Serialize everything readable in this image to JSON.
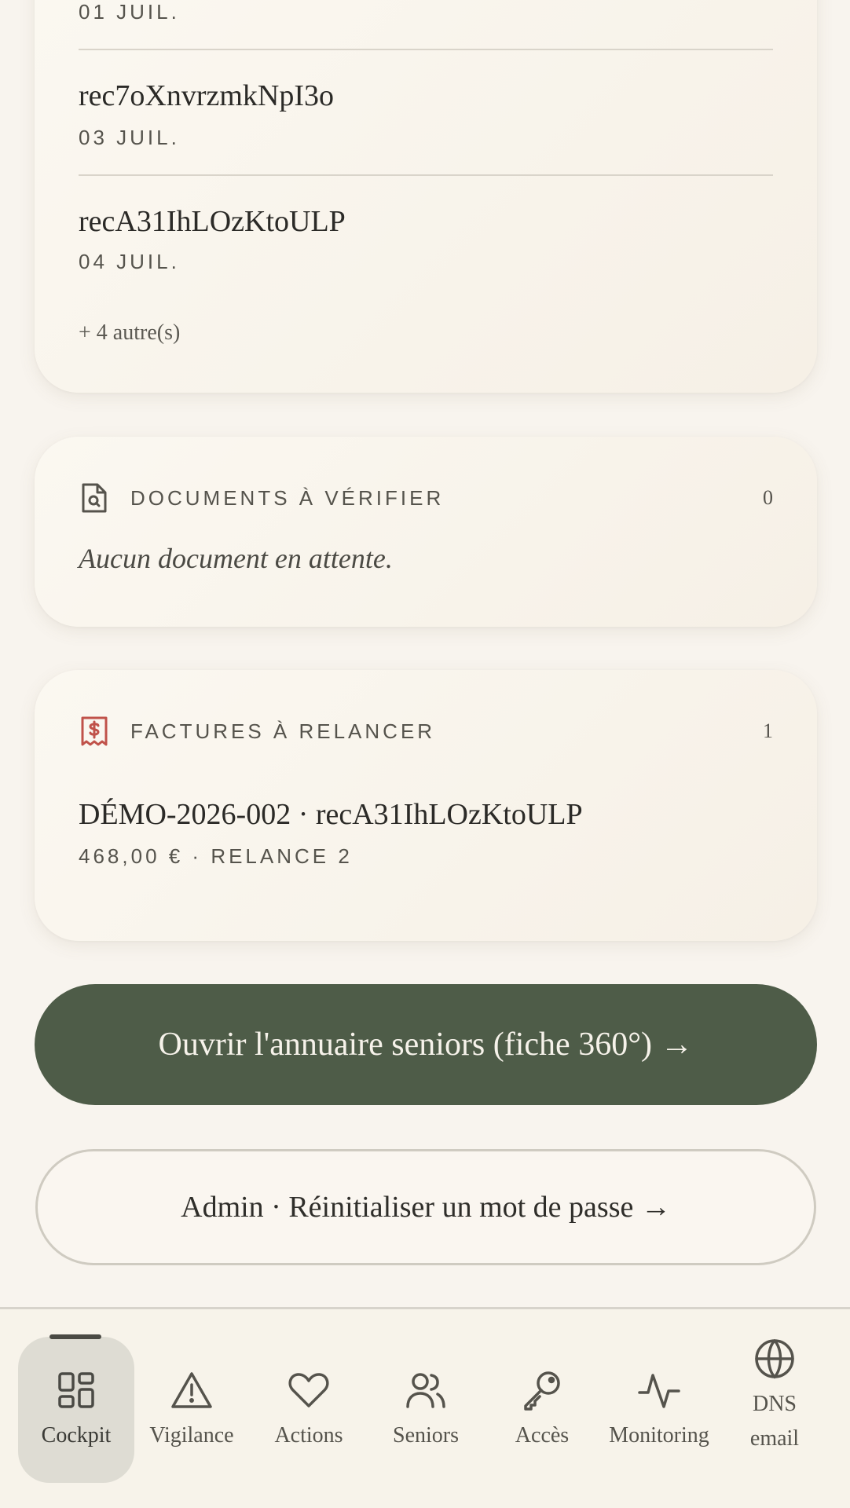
{
  "upcoming": {
    "items": [
      {
        "title": "",
        "date": "01 JUIL."
      },
      {
        "title": "rec7oXnvrzmkNpI3o",
        "date": "03 JUIL."
      },
      {
        "title": "recA31IhLOzKtoULP",
        "date": "04 JUIL."
      }
    ],
    "more_label": "+ 4 autre(s)"
  },
  "documents": {
    "title": "DOCUMENTS À VÉRIFIER",
    "count": "0",
    "empty_text": "Aucun document en attente.",
    "icon": "document-search-icon"
  },
  "invoices": {
    "title": "FACTURES À RELANCER",
    "count": "1",
    "icon": "invoice-dollar-icon",
    "accent": "#c0524a",
    "items": [
      {
        "title": "DÉMO-2026-002 · recA31IhLOzKtoULP",
        "meta": "468,00 € · RELANCE 2"
      }
    ]
  },
  "actions": {
    "primary_label": "Ouvrir l'annuaire seniors (fiche 360°) →",
    "secondary_label": "Admin · Réinitialiser un mot de passe →"
  },
  "nav": {
    "items": [
      {
        "label": "Cockpit",
        "icon": "grid-icon",
        "active": true
      },
      {
        "label": "Vigilance",
        "icon": "warning-triangle-icon",
        "active": false
      },
      {
        "label": "Actions",
        "icon": "heart-icon",
        "active": false
      },
      {
        "label": "Seniors",
        "icon": "users-icon",
        "active": false
      },
      {
        "label": "Accès",
        "icon": "key-icon",
        "active": false
      },
      {
        "label": "Monitoring",
        "icon": "activity-icon",
        "active": false
      },
      {
        "label": "DNS email",
        "icon": "globe-icon",
        "active": false
      }
    ]
  },
  "colors": {
    "background": "#f8f4ee",
    "primary_button": "#4e5c48",
    "card": "#faf6ef",
    "invoice_icon": "#c0524a"
  }
}
